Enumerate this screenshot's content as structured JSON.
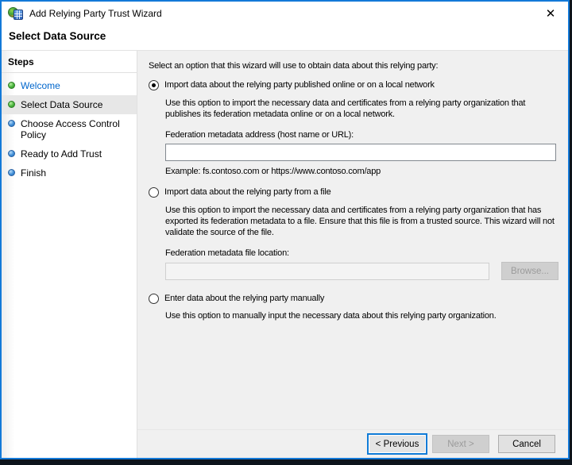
{
  "window": {
    "title": "Add Relying Party Trust Wizard",
    "close_glyph": "✕",
    "accent_color": "#1379d8"
  },
  "page": {
    "heading": "Select Data Source"
  },
  "sidebar": {
    "header": "Steps",
    "done_bullet_color": "#3daa36",
    "todo_bullet_color": "#2f7cc3",
    "link_color": "#0066cc",
    "items": [
      {
        "label": "Welcome",
        "state": "done",
        "current": false
      },
      {
        "label": "Select Data Source",
        "state": "done",
        "current": true
      },
      {
        "label": "Choose Access Control Policy",
        "state": "todo",
        "current": false
      },
      {
        "label": "Ready to Add Trust",
        "state": "todo",
        "current": false
      },
      {
        "label": "Finish",
        "state": "todo",
        "current": false
      }
    ]
  },
  "content": {
    "instruction": "Select an option that this wizard will use to obtain data about this relying party:",
    "options": {
      "online": {
        "selected": true,
        "label": "Import data about the relying party published online or on a local network",
        "description": "Use this option to import the necessary data and certificates from a relying party organization that publishes its federation metadata online or on a local network.",
        "field_label": "Federation metadata address (host name or URL):",
        "field_value": "",
        "example": "Example: fs.contoso.com or https://www.contoso.com/app"
      },
      "file": {
        "selected": false,
        "label": "Import data about the relying party from a file",
        "description": "Use this option to import the necessary data and certificates from a relying party organization that has exported its federation metadata to a file. Ensure that this file is from a trusted source.  This wizard will not validate the source of the file.",
        "field_label": "Federation metadata file location:",
        "field_value": "",
        "browse_label": "Browse..."
      },
      "manual": {
        "selected": false,
        "label": "Enter data about the relying party manually",
        "description": "Use this option to manually input the necessary data about this relying party organization."
      }
    }
  },
  "footer": {
    "previous_label": "< Previous",
    "next_label": "Next >",
    "cancel_label": "Cancel"
  }
}
